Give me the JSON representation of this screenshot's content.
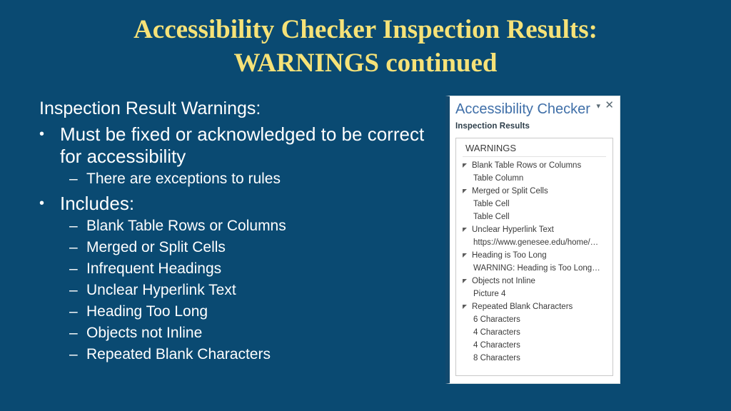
{
  "slide": {
    "background_color": "#0a4a72",
    "title_color": "#f6e278",
    "body_text_color": "#ffffff",
    "title_lines": [
      "Accessibility Checker Inspection Results:",
      "WARNINGS continued"
    ]
  },
  "body": {
    "lead": "Inspection Result Warnings:",
    "bullets": [
      {
        "marker": "•",
        "text": "Must be fixed or acknowledged to be correct for accessibility",
        "children": [
          {
            "marker": "–",
            "text": "There are exceptions to rules"
          }
        ]
      },
      {
        "marker": "•",
        "text": "Includes:",
        "children": [
          {
            "marker": "–",
            "text": "Blank Table Rows or Columns"
          },
          {
            "marker": "–",
            "text": "Merged or Split Cells"
          },
          {
            "marker": "–",
            "text": "Infrequent Headings"
          },
          {
            "marker": "–",
            "text": "Unclear Hyperlink Text"
          },
          {
            "marker": "–",
            "text": "Heading Too Long"
          },
          {
            "marker": "–",
            "text": "Objects not Inline"
          },
          {
            "marker": "–",
            "text": "Repeated Blank Characters"
          }
        ]
      }
    ]
  },
  "panel": {
    "title": "Accessibility Checker",
    "title_color": "#3f6fa8",
    "caret_glyph": "▾",
    "close_glyph": "✕",
    "subheading": "Inspection Results",
    "group_label": "WARNINGS",
    "results": [
      {
        "type": "group",
        "label": "Blank Table Rows or Columns"
      },
      {
        "type": "item",
        "label": "Table Column"
      },
      {
        "type": "group",
        "label": "Merged or Split Cells"
      },
      {
        "type": "item",
        "label": "Table Cell"
      },
      {
        "type": "item",
        "label": "Table Cell"
      },
      {
        "type": "group",
        "label": "Unclear Hyperlink Text"
      },
      {
        "type": "item",
        "label": "https://www.genesee.edu/home/…"
      },
      {
        "type": "group",
        "label": "Heading is Too Long"
      },
      {
        "type": "item",
        "label": "WARNING: Heading is Too Long…"
      },
      {
        "type": "group",
        "label": "Objects not Inline"
      },
      {
        "type": "item",
        "label": "Picture 4"
      },
      {
        "type": "group",
        "label": "Repeated Blank Characters"
      },
      {
        "type": "item",
        "label": "6 Characters"
      },
      {
        "type": "item",
        "label": "4 Characters"
      },
      {
        "type": "item",
        "label": "4 Characters"
      },
      {
        "type": "item",
        "label": "8 Characters"
      }
    ]
  }
}
